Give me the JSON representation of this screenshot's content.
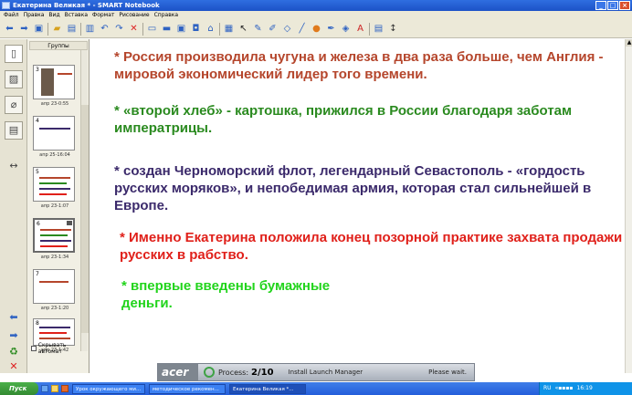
{
  "window": {
    "title": "Екатерина Великая * - SMART Notebook",
    "minimize_glyph": "_",
    "maximize_glyph": "□",
    "close_glyph": "×"
  },
  "menu": [
    "Файл",
    "Правка",
    "Вид",
    "Вставка",
    "Формат",
    "Рисование",
    "Справка"
  ],
  "sorter": {
    "header": "Группы",
    "autohide_label": "Скрывать автомат",
    "thumbnails": [
      {
        "num": "3",
        "caption": "апр 23-0:55"
      },
      {
        "num": "4",
        "caption": "апр 25-16:04"
      },
      {
        "num": "5",
        "caption": "апр 23-1:07"
      },
      {
        "num": "6",
        "caption": "апр 23-1:34"
      },
      {
        "num": "7",
        "caption": "апр 23-1:20"
      },
      {
        "num": "8",
        "caption": "апр 23-1:42"
      }
    ]
  },
  "slide": {
    "items": [
      {
        "text": "* Россия производила чугуна и железа в два раза больше, чем Англия - мировой экономический лидер того времени.",
        "color": "#b5462c"
      },
      {
        "text": "* «второй хлеб» - картошка, прижился в России благодаря заботам императрицы.",
        "color": "#2a8a1f"
      },
      {
        "text": "*  создан  Черноморский флот, легендарный Севастополь - «гордость русских моряков», и непобедимая армия, которая стал сильнейшей в Европе.",
        "color": "#3b2a6b"
      },
      {
        "text": "* Именно Екатерина положила конец позорной практике захвата продажи русских в рабство.",
        "color": "#e0201a"
      },
      {
        "text": "* впервые введены бумажные деньги.",
        "color": "#22d41c"
      }
    ]
  },
  "banner": {
    "brand": "acer",
    "process_label": "Process:",
    "process_value": "2/10",
    "status": "Install Launch Manager",
    "wait": "Please wait."
  },
  "taskbar": {
    "start": "Пуск",
    "tasks": [
      "Урок окружающего ми...",
      "методическое рекомен...",
      "Екатерина Великая *..."
    ],
    "lang": "RU",
    "clock": "16:19"
  }
}
